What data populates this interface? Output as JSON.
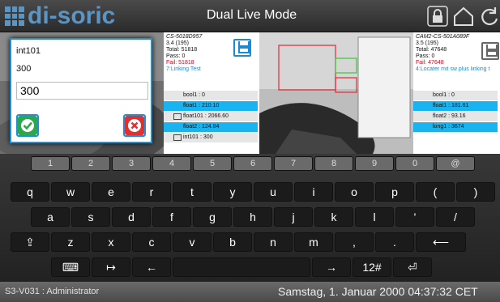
{
  "header": {
    "logo_text": "di-soric",
    "title": "Dual Live Mode",
    "icons": [
      "lock-icon",
      "home-icon",
      "refresh-icon"
    ]
  },
  "dialog": {
    "name": "int101",
    "current_value": "300",
    "input_value": "300",
    "icons": [
      "checkmark-icon",
      "close-icon"
    ],
    "colors": {
      "ok": "#2aa84a",
      "cancel": "#e03030"
    }
  },
  "camera1": {
    "name": "CS-5018D957",
    "version": "3.4 (195)",
    "total": "Total: 51818",
    "pass": "Pass: 0",
    "fail": "Fail: 51818",
    "job": "7:Linking Test",
    "variables": [
      {
        "label": "bool1 : 0",
        "selected": false,
        "editable": false
      },
      {
        "label": "float1 : 210.10",
        "selected": true,
        "editable": false
      },
      {
        "label": "float101 : 2066.60",
        "selected": false,
        "editable": true
      },
      {
        "label": "float2 : 124.84",
        "selected": true,
        "editable": false
      },
      {
        "label": "int101 : 300",
        "selected": false,
        "editable": true
      }
    ]
  },
  "camera2": {
    "name": "CAM2-CS-501A089F",
    "version": "3.5 (195)",
    "total": "Total: 47648",
    "pass": "Pass: 0",
    "fail": "Fail: 47648",
    "job": "4:Locater mit sw plus linking t",
    "variables": [
      {
        "label": "bool1 : 0",
        "selected": false
      },
      {
        "label": "float1 : 181.61",
        "selected": true
      },
      {
        "label": "float2 : 93.16",
        "selected": false
      },
      {
        "label": "long1 : 3674",
        "selected": true
      }
    ]
  },
  "keyboard": {
    "row_numbers": [
      "1",
      "2",
      "3",
      "4",
      "5",
      "6",
      "7",
      "8",
      "9",
      "0",
      "@"
    ],
    "row1": [
      "q",
      "w",
      "e",
      "r",
      "t",
      "y",
      "u",
      "i",
      "o",
      "p",
      "(",
      ")"
    ],
    "row2": [
      "a",
      "s",
      "d",
      "f",
      "g",
      "h",
      "j",
      "k",
      "l",
      "'",
      "/"
    ],
    "row3": [
      "⇪",
      "z",
      "x",
      "c",
      "v",
      "b",
      "n",
      "m",
      ",",
      ".",
      "⟵"
    ],
    "row4": [
      "⌨",
      "↦",
      "←",
      "",
      "→",
      "12#",
      "⏎"
    ]
  },
  "status": {
    "user": "S3-V031 : Administrator",
    "datetime": "Samstag, 1. Januar 2000 04:37:32 CET"
  },
  "colors": {
    "accent": "#1f8fd6",
    "brand": "#5b95c4",
    "highlight": "#19b3ef",
    "fail": "#d0021b"
  }
}
